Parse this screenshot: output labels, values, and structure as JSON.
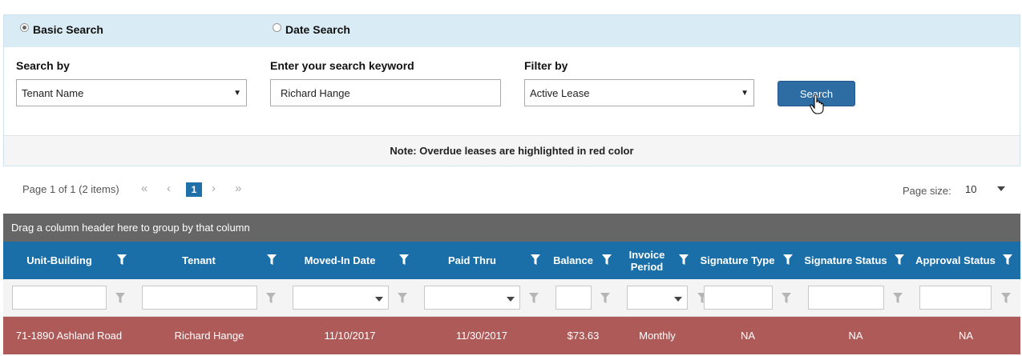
{
  "search_modes": {
    "basic_label": "Basic Search",
    "date_label": "Date Search",
    "selected": "basic"
  },
  "search_form": {
    "search_by_label": "Search by",
    "search_by_value": "Tenant Name",
    "keyword_label": "Enter your search keyword",
    "keyword_value": "Richard Hange",
    "filter_by_label": "Filter by",
    "filter_by_value": "Active Lease",
    "search_button": "Search"
  },
  "note": "Note: Overdue leases are highlighted in red color",
  "pager": {
    "info": "Page 1 of 1 (2 items)",
    "current_page": "1",
    "page_size_label": "Page size:",
    "page_size_value": "10"
  },
  "grid": {
    "group_hint": "Drag a column header here to group by that column",
    "columns": [
      {
        "label": "Unit-Building"
      },
      {
        "label": "Tenant"
      },
      {
        "label": "Moved-In Date"
      },
      {
        "label": "Paid Thru"
      },
      {
        "label": "Balance"
      },
      {
        "label": "Invoice Period"
      },
      {
        "label": "Signature Type"
      },
      {
        "label": "Signature Status"
      },
      {
        "label": "Approval Status"
      }
    ],
    "rows": [
      {
        "unit_building": "71-1890 Ashland Road",
        "tenant": "Richard Hange",
        "moved_in": "11/10/2017",
        "paid_thru": "11/30/2017",
        "balance": "$73.63",
        "invoice_period": "Monthly",
        "signature_type": "NA",
        "signature_status": "NA",
        "approval_status": "NA"
      }
    ]
  },
  "colors": {
    "header_blue": "#1b6fa8",
    "overdue_red": "#ad5a58",
    "button_blue": "#2e6da4"
  }
}
